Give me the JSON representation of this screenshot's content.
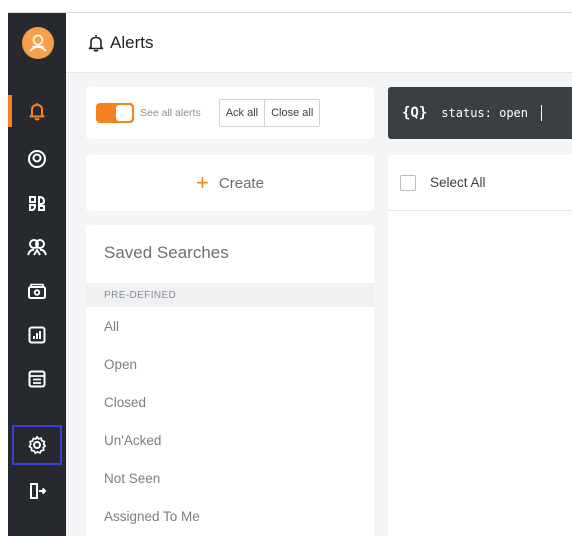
{
  "header": {
    "title": "Alerts",
    "icon": "bell-icon"
  },
  "sidebar": {
    "logo": "logo-icon",
    "items": [
      {
        "name": "alerts",
        "icon": "bell-icon",
        "active": true
      },
      {
        "name": "profile",
        "icon": "user-circle-icon"
      },
      {
        "name": "integrations",
        "icon": "integration-icon"
      },
      {
        "name": "teams",
        "icon": "team-icon"
      },
      {
        "name": "billing",
        "icon": "wallet-icon"
      },
      {
        "name": "reports",
        "icon": "chart-icon"
      },
      {
        "name": "schedules",
        "icon": "calendar-icon"
      },
      {
        "name": "settings",
        "icon": "gear-icon",
        "highlighted": true
      },
      {
        "name": "logout",
        "icon": "logout-icon"
      }
    ]
  },
  "toolbar": {
    "toggle_label": "See all alerts",
    "toggle_on": true,
    "ack_all": "Ack all",
    "close_all": "Close all"
  },
  "search": {
    "icon_text": "{Q}",
    "value": "status: open"
  },
  "create": {
    "plus": "+",
    "label": "Create"
  },
  "saved_searches": {
    "title": "Saved Searches",
    "section": "PRE-DEFINED",
    "items": [
      "All",
      "Open",
      "Closed",
      "Un'Acked",
      "Not Seen",
      "Assigned To Me"
    ]
  },
  "results": {
    "select_all": "Select All"
  },
  "colors": {
    "accent": "#f5821f",
    "sidebar": "#262a2f",
    "searchbar": "#3a3f44",
    "highlight": "#3b3fd6"
  }
}
